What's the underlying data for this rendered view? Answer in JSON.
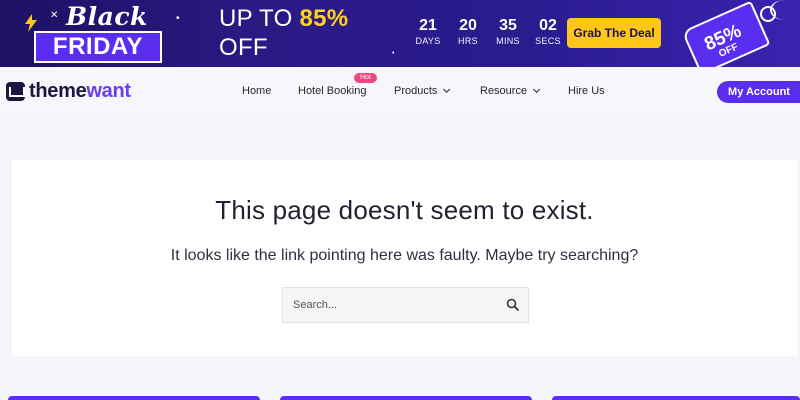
{
  "banner": {
    "black": "Black",
    "friday": "FRIDAY",
    "up_to": "UP TO ",
    "percent": "85%",
    "off": "OFF",
    "countdown": [
      {
        "value": "21",
        "label": "DAYS"
      },
      {
        "value": "20",
        "label": "HRS"
      },
      {
        "value": "35",
        "label": "MINS"
      },
      {
        "value": "02",
        "label": "SECS"
      }
    ],
    "deal_button": "Grab The Deal",
    "tag_percent": "85%",
    "tag_off": "OFF",
    "colors": {
      "background": "#2b1a86",
      "accent": "#ffd31a",
      "button": "#ffc61a"
    }
  },
  "header": {
    "logo_prefix": "theme",
    "logo_suffix": "want",
    "nav": [
      {
        "label": "Home"
      },
      {
        "label": "Hotel Booking",
        "badge": "Hot"
      },
      {
        "label": "Products"
      },
      {
        "label": "Resource"
      },
      {
        "label": "Hire Us"
      }
    ],
    "account_button": "My Account",
    "colors": {
      "brand": "#5b2df0",
      "badge": "#f0457f"
    }
  },
  "main": {
    "title": "This page doesn't seem to exist.",
    "subtitle": "It looks like the link pointing here was faulty. Maybe try searching?",
    "search": {
      "placeholder": "Search...",
      "value": "",
      "icon": "search-icon"
    }
  }
}
